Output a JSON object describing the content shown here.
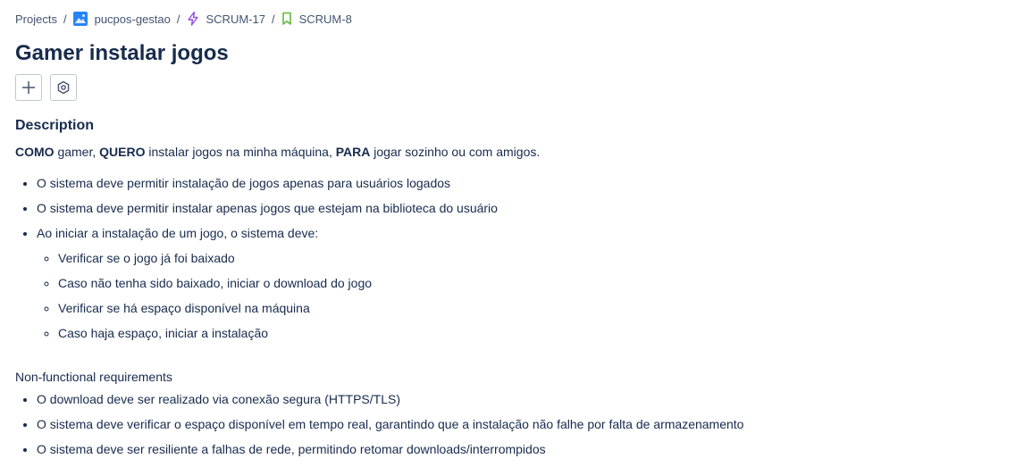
{
  "breadcrumb": {
    "projects": "Projects",
    "project": "pucpos-gestao",
    "epic": "SCRUM-17",
    "story": "SCRUM-8",
    "separator": "/"
  },
  "issue": {
    "title": "Gamer instalar jogos"
  },
  "description": {
    "heading": "Description",
    "story": {
      "w1": "COMO",
      "t1": " gamer, ",
      "w2": "QUERO",
      "t2": " instalar jogos na minha máquina, ",
      "w3": "PARA",
      "t3": " jogar sozinho ou com amigos."
    },
    "requirements": [
      "O sistema deve permitir instalação de jogos apenas para usuários logados",
      "O sistema deve permitir instalar apenas jogos que estejam na biblioteca do usuário",
      "Ao iniciar a instalação de um jogo, o sistema deve:"
    ],
    "install_steps": [
      "Verificar se o jogo já foi baixado",
      "Caso não tenha sido baixado, iniciar o download do jogo",
      "Verificar se há espaço disponível na máquina",
      "Caso haja espaço, iniciar a instalação"
    ],
    "nfr_heading": "Non-functional requirements",
    "nfr": [
      "O download deve ser realizado via conexão segura (HTTPS/TLS)",
      "O sistema deve verificar o espaço disponível em tempo real, garantindo que a instalação não falhe por falta de armazenamento",
      "O sistema deve ser resiliente a falhas de rede, permitindo retomar downloads/interrompidos"
    ]
  },
  "icons": {
    "project": "project-avatar-icon",
    "epic": "epic-lightning-icon",
    "story": "story-bookmark-icon",
    "add": "plus-icon",
    "apps": "hexagon-gear-icon"
  },
  "colors": {
    "epic": "#904ee2",
    "story": "#63ba3c",
    "text": "#172b4d",
    "subtle": "#44546f"
  }
}
